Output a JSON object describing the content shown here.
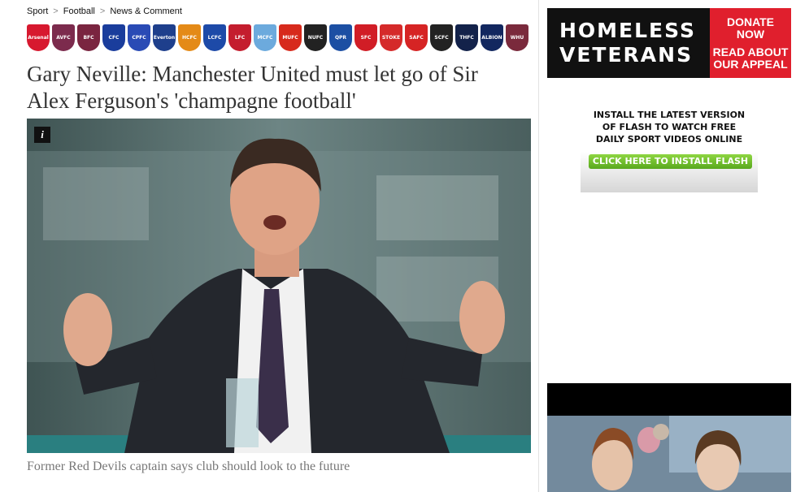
{
  "breadcrumb": {
    "items": [
      "Sport",
      "Football",
      "News & Comment"
    ],
    "separator": ">"
  },
  "crests": [
    {
      "name": "arsenal",
      "label": "Arsenal",
      "color": "#d7192f"
    },
    {
      "name": "aston-villa",
      "label": "AVFC",
      "color": "#7c2b4d"
    },
    {
      "name": "burnley",
      "label": "BFC",
      "color": "#7a2540"
    },
    {
      "name": "chelsea",
      "label": "CFC",
      "color": "#1a3d9c"
    },
    {
      "name": "crystal-palace",
      "label": "CPFC",
      "color": "#2a4bb5"
    },
    {
      "name": "everton",
      "label": "Everton",
      "color": "#1e3f8c"
    },
    {
      "name": "hull-city",
      "label": "HCFC",
      "color": "#e48a17"
    },
    {
      "name": "leicester",
      "label": "LCFC",
      "color": "#1d4aa8"
    },
    {
      "name": "liverpool",
      "label": "LFC",
      "color": "#c41d2e"
    },
    {
      "name": "man-city",
      "label": "MCFC",
      "color": "#6caadd"
    },
    {
      "name": "man-united",
      "label": "MUFC",
      "color": "#d72a1c"
    },
    {
      "name": "newcastle",
      "label": "NUFC",
      "color": "#222222"
    },
    {
      "name": "qpr",
      "label": "QPR",
      "color": "#1c4fa3"
    },
    {
      "name": "southampton",
      "label": "SFC",
      "color": "#d11d26"
    },
    {
      "name": "stoke",
      "label": "STOKE",
      "color": "#d52a2a"
    },
    {
      "name": "sunderland",
      "label": "SAFC",
      "color": "#d62424"
    },
    {
      "name": "swansea",
      "label": "SCFC",
      "color": "#222222"
    },
    {
      "name": "tottenham",
      "label": "THFC",
      "color": "#13224a"
    },
    {
      "name": "west-brom",
      "label": "ALBION",
      "color": "#12275f"
    },
    {
      "name": "west-ham",
      "label": "WHU",
      "color": "#7a2a3c"
    }
  ],
  "article": {
    "headline": "Gary Neville: Manchester United must let go of Sir Alex Ferguson's 'champagne football'",
    "info_icon": "i",
    "caption": "Former Red Devils captain says club should look to the future"
  },
  "ads": {
    "homeless": {
      "line1": "HOMELESS",
      "line2": "VETERANS",
      "cta1": "DONATE NOW",
      "cta2": "READ ABOUT OUR APPEAL",
      "color": "#e01f2d"
    },
    "flash": {
      "line1": "INSTALL THE LATEST VERSION",
      "line2": "OF FLASH TO WATCH FREE",
      "line3": "DAILY SPORT VIDEOS ONLINE",
      "button": "CLICK HERE TO INSTALL FLASH",
      "button_color": "#6cbf2a"
    }
  }
}
